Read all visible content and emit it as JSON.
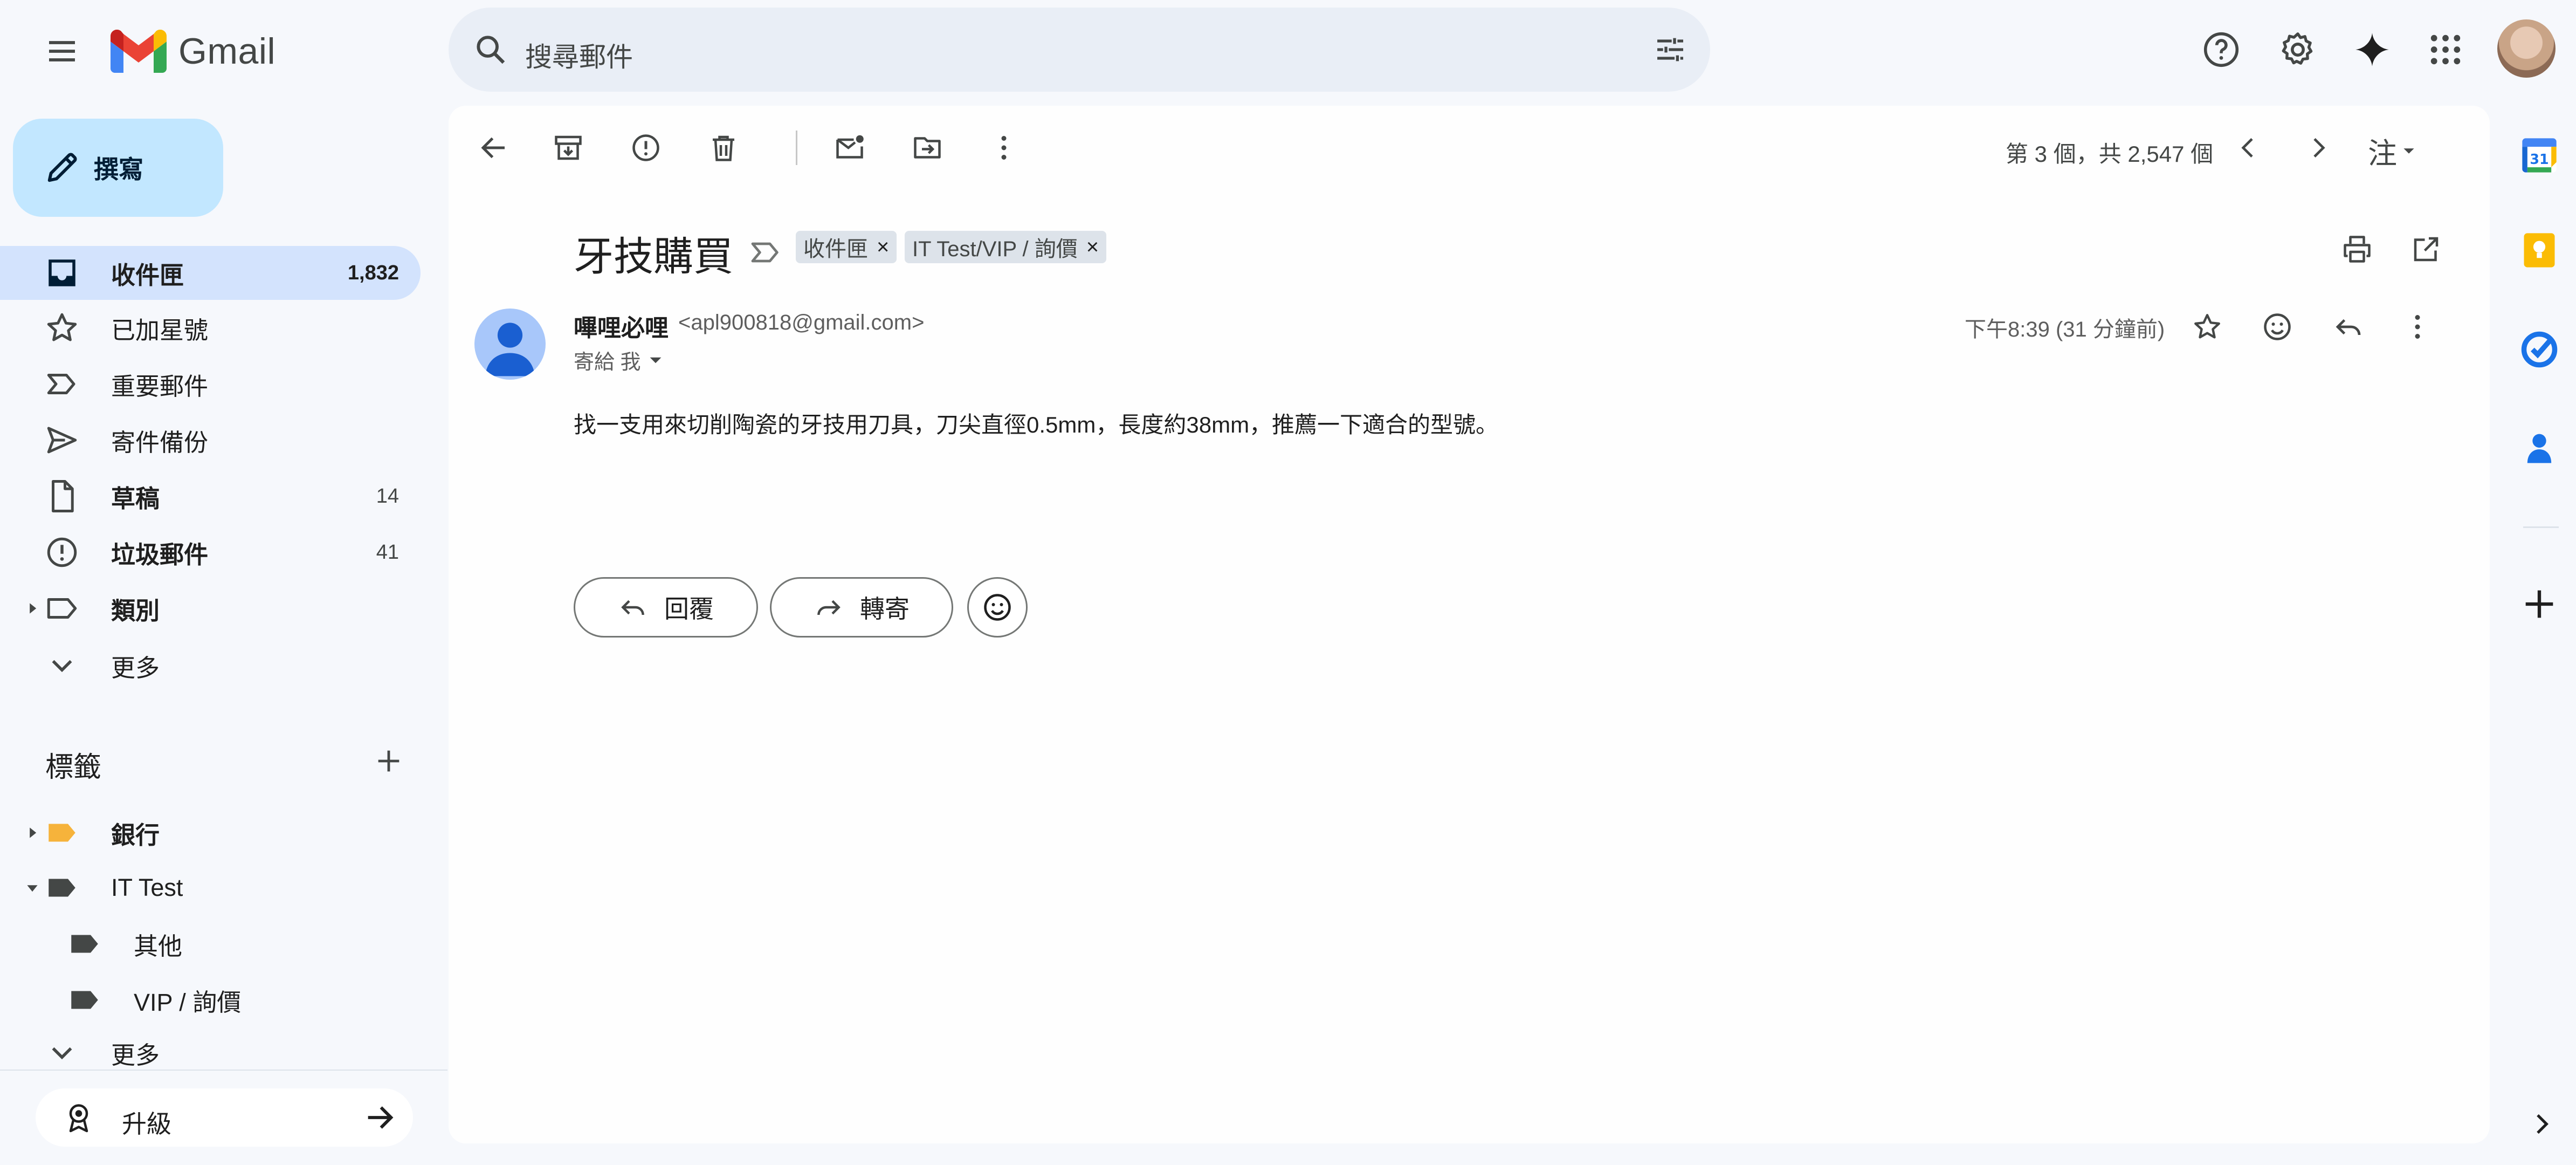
{
  "app": {
    "name": "Gmail"
  },
  "search": {
    "placeholder": "搜尋郵件"
  },
  "compose": {
    "label": "撰寫"
  },
  "nav": [
    {
      "label": "收件匣",
      "count": "1,832",
      "icon": "inbox-icon",
      "active": true,
      "bold": true
    },
    {
      "label": "已加星號",
      "count": "",
      "icon": "star-icon",
      "active": false,
      "bold": false
    },
    {
      "label": "重要郵件",
      "count": "",
      "icon": "important-icon",
      "active": false,
      "bold": false
    },
    {
      "label": "寄件備份",
      "count": "",
      "icon": "send-icon",
      "active": false,
      "bold": false
    },
    {
      "label": "草稿",
      "count": "14",
      "icon": "draft-icon",
      "active": false,
      "bold": true
    },
    {
      "label": "垃圾郵件",
      "count": "41",
      "icon": "spam-icon",
      "active": false,
      "bold": true
    },
    {
      "label": "類別",
      "count": "",
      "icon": "label-outline-icon",
      "active": false,
      "bold": true
    },
    {
      "label": "更多",
      "count": "",
      "icon": "chevron-down-icon",
      "active": false,
      "bold": false
    }
  ],
  "labels": {
    "header": "標籤",
    "items": [
      {
        "label": "銀行",
        "color": "#f6b33b",
        "bold": true
      },
      {
        "label": "IT Test",
        "color": "#444746",
        "bold": false
      },
      {
        "label": "其他",
        "color": "#444746",
        "bold": false
      },
      {
        "label": "VIP / 詢價",
        "color": "#444746",
        "bold": false
      }
    ],
    "more": "更多"
  },
  "upgrade": {
    "label": "升級"
  },
  "toolbar": {
    "pager": "第 3 個，共 2,547 個",
    "language": "注"
  },
  "email": {
    "subject": "牙技購買",
    "chips": [
      {
        "label": "收件匣",
        "close": "×"
      },
      {
        "label": "IT Test/VIP / 詢價",
        "close": "×"
      }
    ],
    "sender_name": "嗶哩必哩",
    "sender_email": "<apl900818@gmail.com>",
    "recipient": "寄給 我",
    "timestamp": "下午8:39 (31 分鐘前)",
    "body": "找一支用來切削陶瓷的牙技用刀具，刀尖直徑0.5mm，長度約38mm，推薦一下適合的型號。",
    "reply_label": "回覆",
    "forward_label": "轉寄"
  },
  "side_panel": {
    "calendar_day": "31"
  },
  "colors": {
    "background": "#f6f8fc",
    "compose": "#c2e7ff",
    "active_nav": "#d3e3fd",
    "bank_label": "#f6b33b"
  }
}
